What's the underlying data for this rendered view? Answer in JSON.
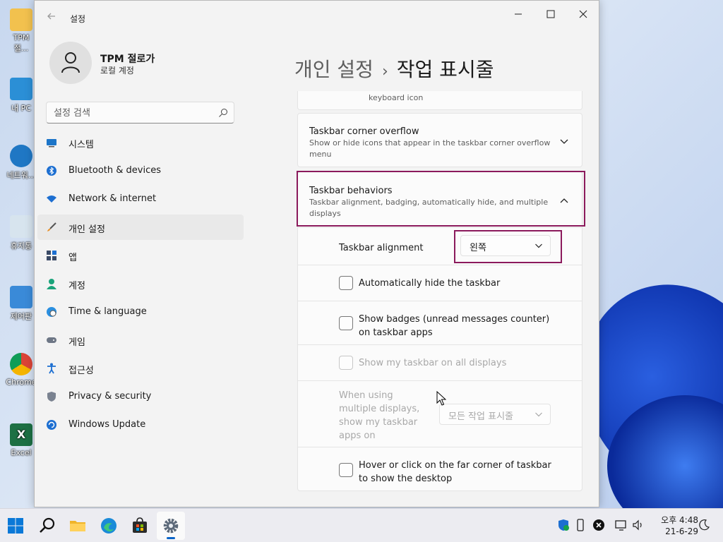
{
  "desktop": {
    "icons": [
      {
        "label": "TPM 절..."
      },
      {
        "label": "내 PC"
      },
      {
        "label": "네트워..."
      },
      {
        "label": "휴지통"
      },
      {
        "label": "제어판"
      },
      {
        "label": "Chrome"
      },
      {
        "label": "Excel"
      }
    ]
  },
  "window": {
    "app_title": "설정",
    "back_icon": "back-arrow-icon",
    "controls": {
      "minimize": "—",
      "maximize": "☐",
      "close": "✕"
    }
  },
  "profile": {
    "name": "TPM 절로가",
    "account_type": "로컬 계정"
  },
  "search": {
    "placeholder": "설정 검색"
  },
  "nav": {
    "items": [
      {
        "label": "시스템",
        "icon": "monitor-icon",
        "active": false
      },
      {
        "label": "Bluetooth & devices",
        "icon": "bluetooth-icon",
        "active": false
      },
      {
        "label": "Network & internet",
        "icon": "wifi-icon",
        "active": false
      },
      {
        "label": "개인 설정",
        "icon": "brush-icon",
        "active": true
      },
      {
        "label": "앱",
        "icon": "apps-icon",
        "active": false
      },
      {
        "label": "계정",
        "icon": "person-icon",
        "active": false
      },
      {
        "label": "Time & language",
        "icon": "globe-clock-icon",
        "active": false
      },
      {
        "label": "게임",
        "icon": "gamepad-icon",
        "active": false
      },
      {
        "label": "접근성",
        "icon": "accessibility-icon",
        "active": false
      },
      {
        "label": "Privacy & security",
        "icon": "shield-icon",
        "active": false
      },
      {
        "label": "Windows Update",
        "icon": "update-icon",
        "active": false
      }
    ]
  },
  "heading": {
    "parent": "개인 설정",
    "separator": "›",
    "current": "작업 표시줄"
  },
  "content": {
    "partial_card_text": "keyboard icon",
    "corner_overflow": {
      "title": "Taskbar corner overflow",
      "description": "Show or hide icons that appear in the taskbar corner overflow menu"
    },
    "behaviors": {
      "title": "Taskbar behaviors",
      "description": "Taskbar alignment, badging, automatically hide, and multiple displays"
    },
    "alignment": {
      "label": "Taskbar alignment",
      "value": "왼쪽"
    },
    "auto_hide": {
      "label": "Automatically hide the taskbar",
      "checked": false
    },
    "badges": {
      "label_line1": "Show badges (unread messages counter)",
      "label_line2": "on taskbar apps",
      "checked": false
    },
    "all_displays": {
      "label": "Show my taskbar on all displays",
      "checked": false,
      "disabled": true
    },
    "multi_display": {
      "label_lines": [
        "When using",
        "multiple displays,",
        "show my taskbar",
        "apps on"
      ],
      "value": "모든 작업 표시줄",
      "disabled": true
    },
    "hover_corner": {
      "label_line1": "Hover or click on the far corner of taskbar",
      "label_line2": "to show the desktop",
      "checked": false
    }
  },
  "taskbar": {
    "apps": [
      "start-icon",
      "search-icon",
      "file-explorer-icon",
      "edge-icon",
      "store-icon",
      "settings-icon"
    ],
    "clock": {
      "time": "오후 4:48",
      "date": "21-6-29"
    }
  },
  "colors": {
    "highlight": "#8b1a5c",
    "accent": "#0a64c8"
  }
}
